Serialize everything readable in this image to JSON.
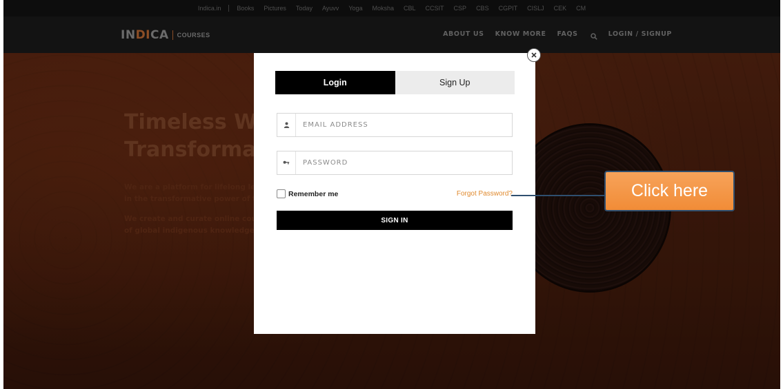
{
  "topbar": {
    "items": [
      "Indica.in",
      "Books",
      "Pictures",
      "Today",
      "Ayuvv",
      "Yoga",
      "Moksha",
      "CBL",
      "CCSIT",
      "CSP",
      "CBS",
      "CGPIT",
      "CISLJ",
      "CEK",
      "CM"
    ]
  },
  "header": {
    "logo_main": "INDICA",
    "logo_sub": "COURSES",
    "nav": {
      "about": "ABOUT US",
      "know_more": "KNOW MORE",
      "faqs": "FAQS",
      "login": "LOGIN / SIGNUP"
    }
  },
  "hero": {
    "title_line1": "Timeless Wis",
    "title_line2": "Transformati",
    "para1_line1": "We are a platform for lifelong learn",
    "para1_line2": "in the transformative power of tim",
    "para2_line1": "We create and curate online cours",
    "para2_line2": "of global indigenous knowledge sy"
  },
  "modal": {
    "tabs": {
      "login": "Login",
      "signup": "Sign Up"
    },
    "email_placeholder": "EMAIL ADDRESS",
    "password_placeholder": "PASSWORD",
    "remember_label": "Remember me",
    "forgot_label": "Forgot Password?",
    "signin_label": "SIGN IN"
  },
  "callout": {
    "text": "Click here"
  },
  "colors": {
    "accent": "#e08a2e",
    "callout_fill": "#f18c37",
    "callout_border": "#2f4f6f",
    "header_bg": "#161616",
    "hero_bg": "#3a1a0e"
  }
}
